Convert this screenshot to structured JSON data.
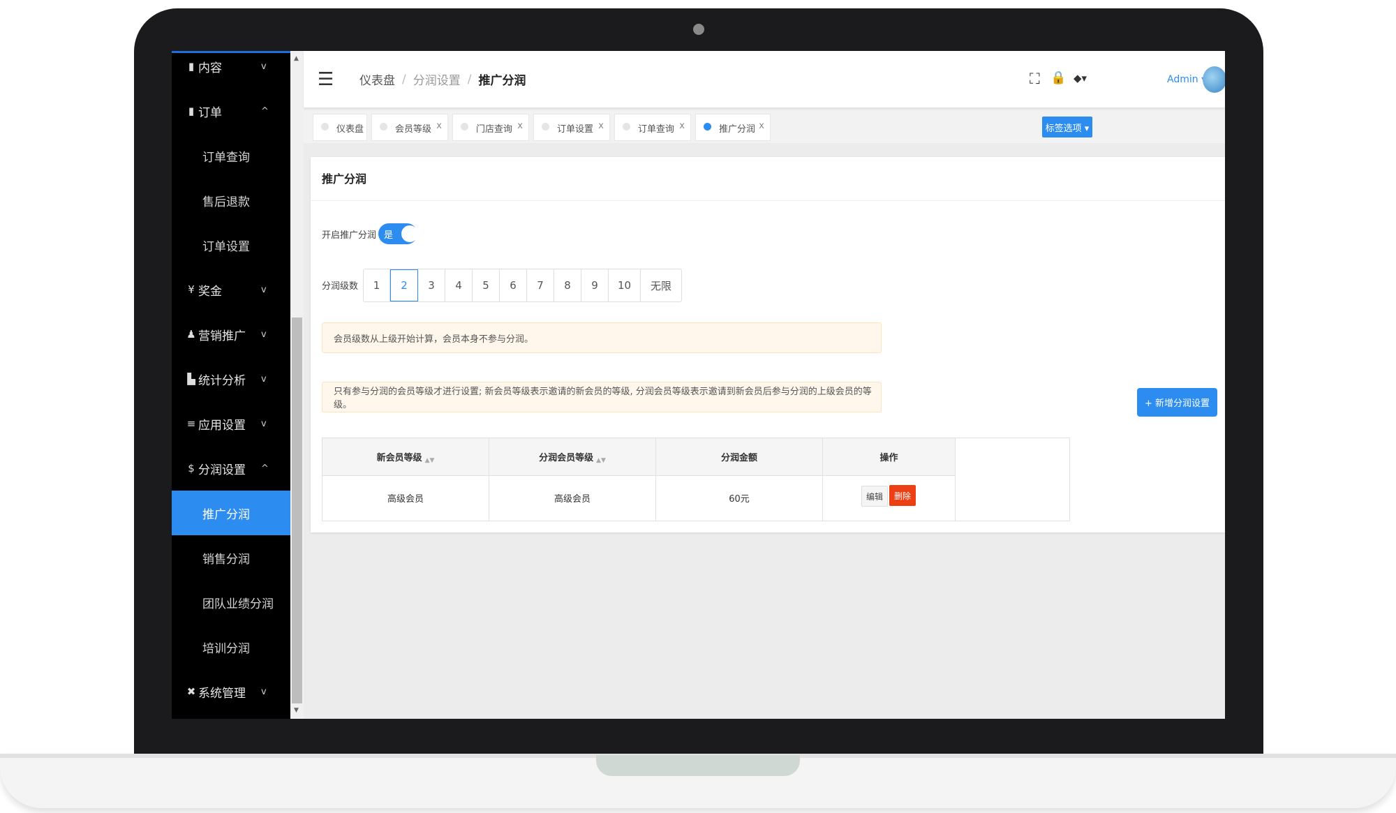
{
  "sidebar": {
    "items": [
      {
        "icon": "document-icon",
        "glyph": "▮",
        "label": "内容",
        "arrow": "v"
      },
      {
        "icon": "document-icon",
        "glyph": "▮",
        "label": "订单",
        "arrow": "^"
      },
      {
        "label": "订单查询"
      },
      {
        "label": "售后退款"
      },
      {
        "label": "订单设置"
      },
      {
        "icon": "yen-icon",
        "glyph": "¥",
        "label": "奖金",
        "arrow": "v"
      },
      {
        "icon": "gamepad-icon",
        "glyph": "♟",
        "label": "营销推广",
        "arrow": "v"
      },
      {
        "icon": "bar-chart-icon",
        "glyph": "▙",
        "label": "统计分析",
        "arrow": "v"
      },
      {
        "icon": "list-icon",
        "glyph": "≡",
        "label": "应用设置",
        "arrow": "v"
      },
      {
        "icon": "dollar-icon",
        "glyph": "$",
        "label": "分润设置",
        "arrow": "^"
      },
      {
        "label": "推广分润"
      },
      {
        "label": "销售分润"
      },
      {
        "label": "团队业绩分润"
      },
      {
        "label": "培训分润"
      },
      {
        "icon": "wrench-icon",
        "glyph": "✖",
        "label": "系统管理",
        "arrow": "v"
      }
    ]
  },
  "header": {
    "menu_glyph": "☰",
    "breadcrumb": [
      "仪表盘",
      "分润设置",
      "推广分润"
    ],
    "breadcrumb_sep": "/",
    "fullscreen_glyph": "⛶",
    "lock_glyph": "🔒",
    "theme_glyph": "◆▾",
    "admin_label": "Admin ▾"
  },
  "tabs": [
    {
      "label": "仪表盘",
      "close": ""
    },
    {
      "label": "会员等级",
      "close": "x"
    },
    {
      "label": "门店查询",
      "close": "x"
    },
    {
      "label": "订单设置",
      "close": "x"
    },
    {
      "label": "订单查询",
      "close": "x"
    },
    {
      "label": "推广分润",
      "close": "x",
      "active": true
    }
  ],
  "tab_options_label": "标签选项 ▾",
  "card": {
    "title": "推广分润",
    "enable_label": "开启推广分润",
    "switch_text": "是",
    "levels_label": "分润级数",
    "levels": [
      "1",
      "2",
      "3",
      "4",
      "5",
      "6",
      "7",
      "8",
      "9",
      "10",
      "无限"
    ],
    "selected_level": "2",
    "alert1": "会员级数从上级开始计算，会员本身不参与分润。",
    "alert2": "只有参与分润的会员等级才进行设置; 新会员等级表示邀请的新会员的等级, 分润会员等级表示邀请到新会员后参与分润的上级会员的等级。",
    "add_button": "+ 新增分润设置"
  },
  "table": {
    "headers": [
      "新会员等级",
      "分润会员等级",
      "分润金额",
      "操作"
    ],
    "sort_glyph": "▲▼",
    "rows": [
      {
        "new_level": "高级会员",
        "profit_level": "高级会员",
        "amount": "60元",
        "edit": "编辑",
        "delete": "删除"
      }
    ]
  },
  "colors": {
    "accent": "#2d8cf0",
    "danger": "#ed3f14",
    "sidebar_bg": "#000000"
  }
}
